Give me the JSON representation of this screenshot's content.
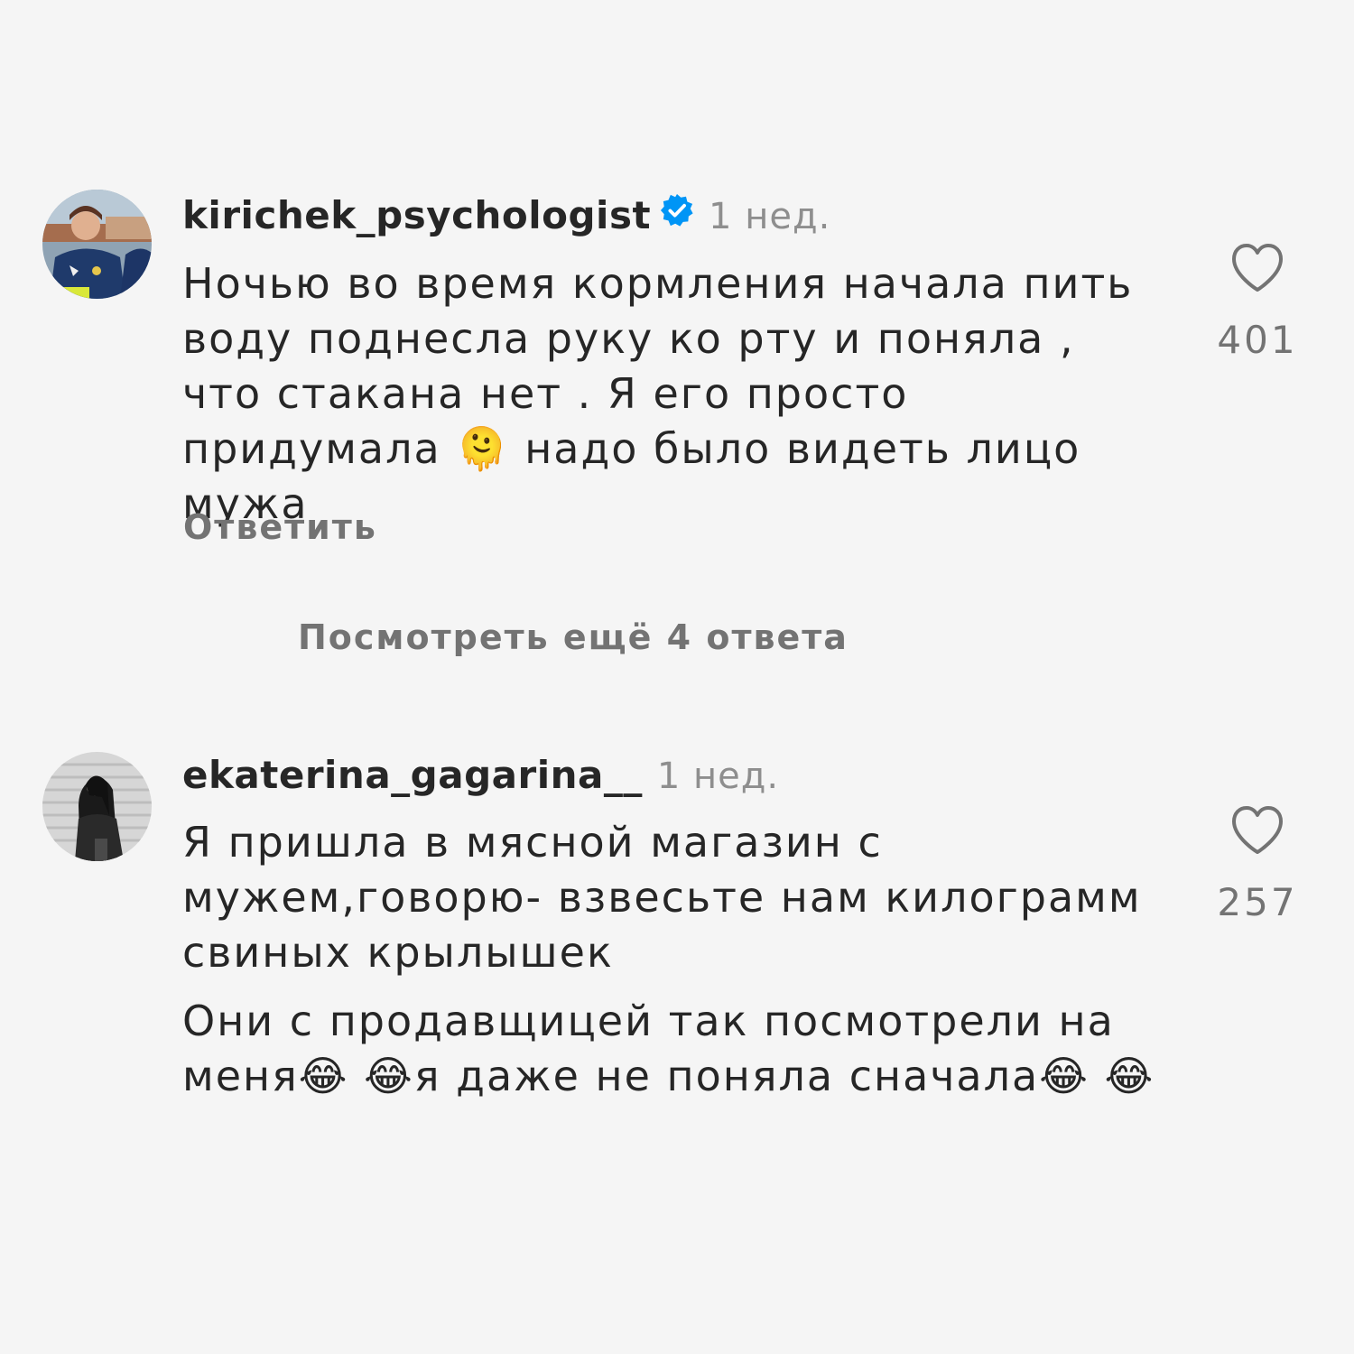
{
  "comments": [
    {
      "username": "kirichek_psychologist",
      "verified": true,
      "time": "1 нед.",
      "paragraphs": [
        "Ночью во время кормления начала пить воду поднесла руку ко рту и поняла , что стакана нет . Я его просто придумала 🫠 надо было видеть лицо мужа"
      ],
      "likes": "401",
      "reply_label": "Ответить"
    },
    {
      "username": "ekaterina_gagarina__",
      "verified": false,
      "time": "1 нед.",
      "paragraphs": [
        "Я пришла в мясной магазин с мужем,говорю- взвесьте нам килограмм свиных крылышек",
        "Они с продавщицей так посмотрели на меня😂 😂я даже не поняла сначала😂 😂"
      ],
      "likes": "257"
    }
  ],
  "more_replies_label": "Посмотреть ещё 4 ответа",
  "colors": {
    "background": "#f5f5f5",
    "text": "#262626",
    "muted": "#737373",
    "timestamp": "#8e8e8e",
    "verified_badge": "#0095f6"
  }
}
